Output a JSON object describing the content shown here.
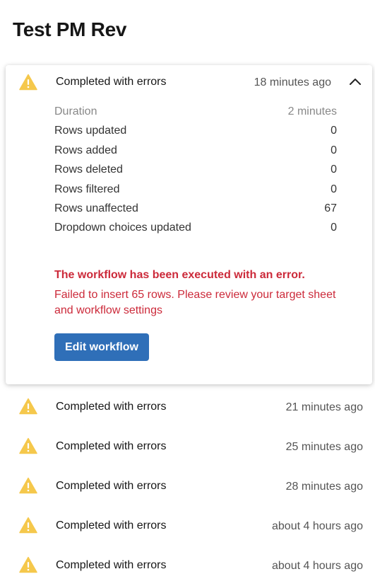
{
  "page": {
    "title": "Test PM Rev"
  },
  "expanded": {
    "status": "Completed with errors",
    "time": "18 minutes ago",
    "details": [
      {
        "label": "Duration",
        "value": "2 minutes"
      },
      {
        "label": "Rows updated",
        "value": "0"
      },
      {
        "label": "Rows added",
        "value": "0"
      },
      {
        "label": "Rows deleted",
        "value": "0"
      },
      {
        "label": "Rows filtered",
        "value": "0"
      },
      {
        "label": "Rows unaffected",
        "value": "67"
      },
      {
        "label": "Dropdown choices updated",
        "value": "0"
      }
    ],
    "error_title": "The workflow has been executed with an error.",
    "error_message": "Failed to insert 65 rows. Please review your target sheet and workflow settings",
    "edit_button": "Edit workflow"
  },
  "runs": [
    {
      "status": "Completed with errors",
      "time": "21 minutes ago"
    },
    {
      "status": "Completed with errors",
      "time": "25 minutes ago"
    },
    {
      "status": "Completed with errors",
      "time": "28 minutes ago"
    },
    {
      "status": "Completed with errors",
      "time": "about 4 hours ago"
    },
    {
      "status": "Completed with errors",
      "time": "about 4 hours ago"
    }
  ],
  "icons": {
    "status": "warning-triangle-icon",
    "collapse": "chevron-up-icon"
  },
  "colors": {
    "warning": "#f5c84c",
    "error": "#cc2a3a",
    "primary": "#2f6fb8"
  }
}
